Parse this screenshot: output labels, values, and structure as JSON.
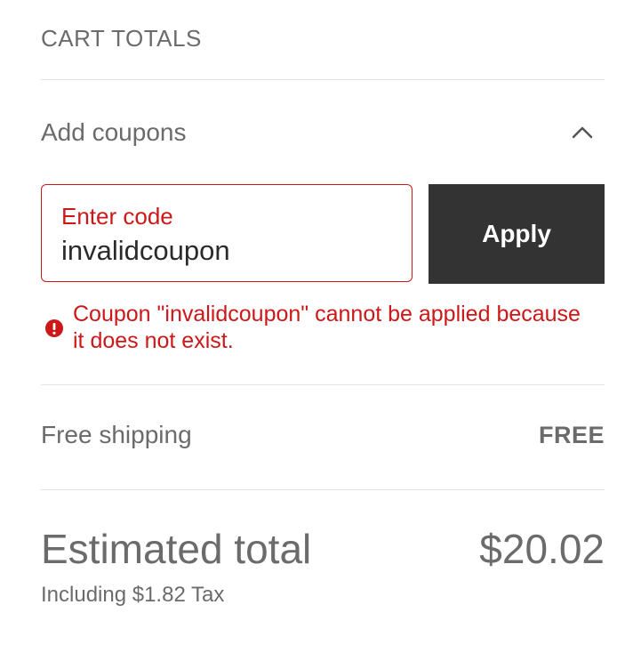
{
  "cart": {
    "title": "CART TOTALS"
  },
  "coupons": {
    "toggle_label": "Add coupons",
    "toggle_icon": "chevron-up-icon",
    "field_label": "Enter code",
    "field_value": "invalidcoupon",
    "apply_label": "Apply",
    "error_icon": "error-icon",
    "error_message": "Coupon \"invalidcoupon\" cannot be applied because it does not exist."
  },
  "shipping": {
    "label": "Free shipping",
    "value": "FREE"
  },
  "total": {
    "label": "Estimated total",
    "value": "$20.02",
    "tax_note": "Including $1.82 Tax"
  },
  "colors": {
    "error": "#cc1818",
    "button_bg": "#333333",
    "text": "#6b6b6b",
    "divider": "#e3e3e3"
  }
}
